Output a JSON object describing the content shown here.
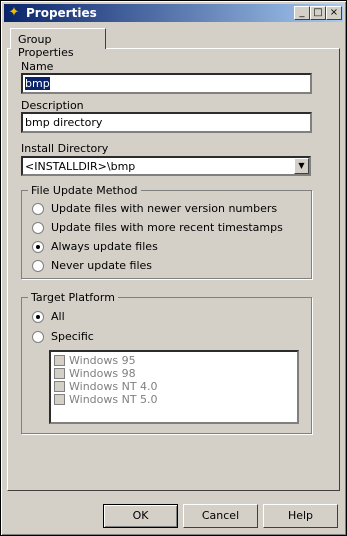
{
  "window": {
    "title": "Properties",
    "controls": {
      "minimize": "_",
      "maximize": "□",
      "close": "×"
    }
  },
  "tab": {
    "label": "Group Properties"
  },
  "name": {
    "label": "Name",
    "value": "bmp"
  },
  "description": {
    "label": "Description",
    "value": "bmp directory"
  },
  "install_directory": {
    "label": "Install Directory",
    "value": "<INSTALLDIR>\\bmp"
  },
  "file_update_method": {
    "title": "File Update Method",
    "options": [
      {
        "label": "Update files with newer version numbers",
        "selected": false
      },
      {
        "label": "Update files with more recent timestamps",
        "selected": false
      },
      {
        "label": "Always update files",
        "selected": true
      },
      {
        "label": "Never update files",
        "selected": false
      }
    ]
  },
  "target_platform": {
    "title": "Target Platform",
    "options": [
      {
        "label": "All",
        "selected": true
      },
      {
        "label": "Specific",
        "selected": false
      }
    ],
    "platforms": [
      "Windows 95",
      "Windows 98",
      "Windows NT 4.0",
      "Windows NT 5.0"
    ]
  },
  "buttons": {
    "ok": "OK",
    "cancel": "Cancel",
    "help": "Help"
  }
}
